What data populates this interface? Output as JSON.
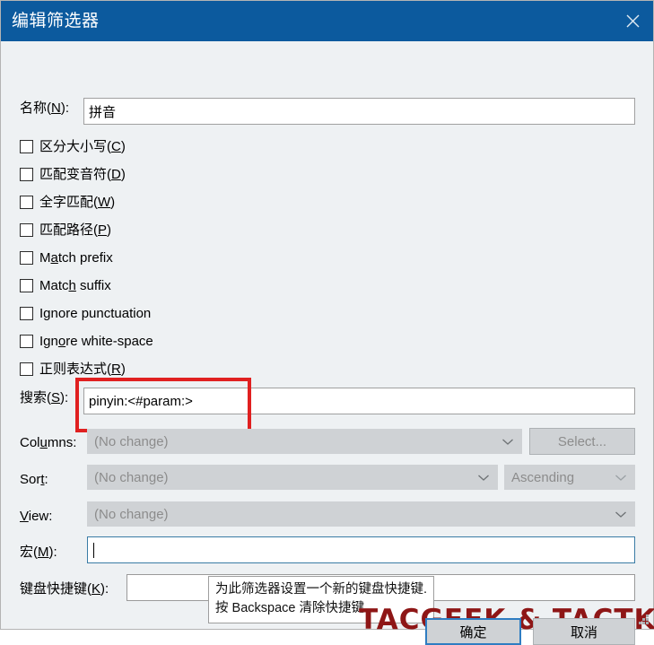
{
  "window": {
    "title": "编辑筛选器",
    "close_icon": "close-icon"
  },
  "name_field": {
    "label_prefix": "名称(",
    "label_accel": "N",
    "label_suffix": "):",
    "value": "拼音"
  },
  "checkboxes": [
    {
      "pre": "",
      "accel": "",
      "post": "区分大小写(C)",
      "checked": false,
      "parts": [
        "区分大小写(",
        "C",
        ")"
      ]
    },
    {
      "parts": [
        "匹配变音符(",
        "D",
        ")"
      ],
      "checked": false
    },
    {
      "parts": [
        "全字匹配(",
        "W",
        ")"
      ],
      "checked": false
    },
    {
      "parts": [
        "匹配路径(",
        "P",
        ")"
      ],
      "checked": false
    },
    {
      "parts": [
        "M",
        "a",
        "tch prefix"
      ],
      "checked": false
    },
    {
      "parts": [
        "Matc",
        "h",
        " suffix"
      ],
      "checked": false
    },
    {
      "parts": [
        "I",
        "g",
        "nore punctuation"
      ],
      "checked": false
    },
    {
      "parts": [
        "Ign",
        "o",
        "re white-space"
      ],
      "checked": false
    },
    {
      "parts": [
        "正则表达式(",
        "R",
        ")"
      ],
      "checked": false
    }
  ],
  "search_field": {
    "label_parts": [
      "搜索(",
      "S",
      "):"
    ],
    "value": "pinyin:<#param:>"
  },
  "columns_row": {
    "label_parts": [
      "Col",
      "u",
      "mns:"
    ],
    "combo_value": "(No change)",
    "button_label": "Select...",
    "chevron_icon": "chevron-down-icon"
  },
  "sort_row": {
    "label_parts": [
      "Sor",
      "t",
      ":"
    ],
    "combo_value": "(No change)",
    "order_value": "Ascending",
    "chevron_icon": "chevron-down-icon"
  },
  "view_row": {
    "label_parts": [
      "",
      "V",
      "iew:"
    ],
    "combo_value": "(No change)",
    "chevron_icon": "chevron-down-icon"
  },
  "macro_field": {
    "label_parts": [
      "宏(",
      "M",
      "):"
    ],
    "value": ""
  },
  "shortcut_field": {
    "label_parts": [
      "键盘快捷键(",
      "K",
      "):"
    ],
    "value": ""
  },
  "tooltip": {
    "line1": "为此筛选器设置一个新的键盘快捷键.",
    "line2": "按 Backspace 清除快捷键"
  },
  "buttons": {
    "ok": "确定",
    "cancel": "取消"
  },
  "watermark": {
    "text": "TACGEEK & TACTK",
    "color": "#8e1616"
  },
  "annotation": {
    "color": "#e02020",
    "target": "search-input"
  },
  "colors": {
    "titlebar": "#0c5a9e",
    "dialog_bg": "#eef1f3",
    "control_disabled": "#cfd2d5",
    "focus_border": "#2f7dc2"
  }
}
